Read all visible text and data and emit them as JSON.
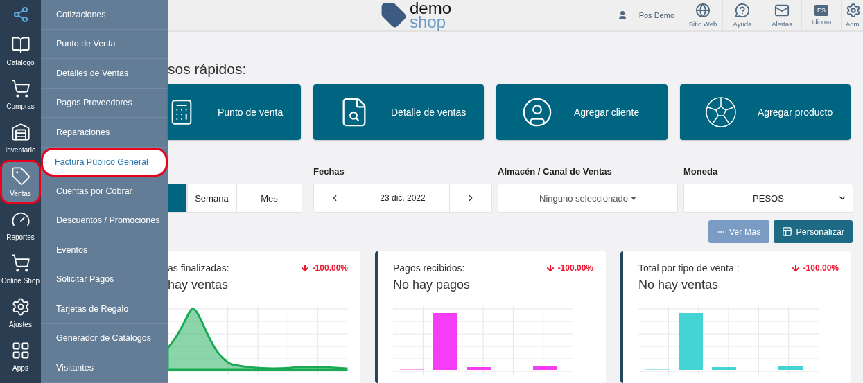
{
  "rail": {
    "items": [
      {
        "kind": "book",
        "label": "Catálogo",
        "selected": false,
        "annotated": false
      },
      {
        "kind": "cart-down",
        "label": "Compras",
        "selected": false,
        "annotated": false
      },
      {
        "kind": "warehouse",
        "label": "Inventario",
        "selected": false,
        "annotated": false
      },
      {
        "kind": "tag",
        "label": "Ventas",
        "selected": true,
        "annotated": true
      },
      {
        "kind": "gauge",
        "label": "Reportes",
        "selected": false,
        "annotated": false
      },
      {
        "kind": "cart",
        "label": "Online Shop",
        "selected": false,
        "annotated": false
      },
      {
        "kind": "gear",
        "label": "Ajustes",
        "selected": false,
        "annotated": false
      },
      {
        "kind": "apps",
        "label": "Apps",
        "selected": false,
        "annotated": false
      }
    ]
  },
  "flyout": {
    "items": [
      {
        "label": "Cotizaciones",
        "selected": false,
        "annotated": false
      },
      {
        "label": "Punto de Venta",
        "selected": false,
        "annotated": false
      },
      {
        "label": "Detalles de Ventas",
        "selected": false,
        "annotated": false
      },
      {
        "label": "Pagos Proveedores",
        "selected": false,
        "annotated": false
      },
      {
        "label": "Reparaciones",
        "selected": false,
        "annotated": false
      },
      {
        "label": "Factura Público General",
        "selected": true,
        "annotated": true
      },
      {
        "label": "Cuentas por Cobrar",
        "selected": false,
        "annotated": false
      },
      {
        "label": "Descuentos / Promociones",
        "selected": false,
        "annotated": false
      },
      {
        "label": "Eventos",
        "selected": false,
        "annotated": false
      },
      {
        "label": "Solicitar Pagos",
        "selected": false,
        "annotated": false
      },
      {
        "label": "Tarjetas de Regalo",
        "selected": false,
        "annotated": false
      },
      {
        "label": "Generador de Catálogos",
        "selected": false,
        "annotated": false
      },
      {
        "label": "Visitantes",
        "selected": false,
        "annotated": false
      }
    ]
  },
  "header": {
    "logo": {
      "line_1": "demo",
      "line_2": "shop"
    },
    "user": {
      "name": "iPos Demo"
    },
    "actions": [
      {
        "kind": "globe",
        "label": "Sitio Web"
      },
      {
        "kind": "help",
        "label": "Ayuda"
      },
      {
        "kind": "mail",
        "label": "Alertas"
      },
      {
        "kind": "language",
        "label": "Idioma",
        "badge": "ES"
      },
      {
        "kind": "gear",
        "label": "Admi"
      }
    ]
  },
  "quick_access": {
    "title": "sos rápidos:",
    "cards": [
      {
        "kind": "register",
        "label": "Punto de venta"
      },
      {
        "kind": "report",
        "label": "Detalle de ventas"
      },
      {
        "kind": "person",
        "label": "Agregar cliente"
      },
      {
        "kind": "ball",
        "label": "Agregar producto"
      }
    ]
  },
  "filters": {
    "period": [
      {
        "selected": true
      },
      {
        "label": "Semana",
        "selected": false
      },
      {
        "label": "Mes",
        "selected": false
      }
    ],
    "dates": {
      "label": "Fechas",
      "value": "23 dic. 2022"
    },
    "warehouse": {
      "label": "Almacén / Canal de Ventas",
      "value": "Ninguno seleccionado"
    },
    "currency": {
      "label": "Moneda",
      "value": "PESOS"
    }
  },
  "buttons": [
    {
      "kind": "more",
      "label": "Ver Más"
    },
    {
      "kind": "customize",
      "label": "Personalizar"
    }
  ],
  "stat_cards": [
    {
      "title": "as finalizadas:",
      "change": "-100.00%",
      "value": "hay ventas",
      "kind": "area",
      "color": "#1aaa55",
      "accent_border": false
    },
    {
      "title": "Pagos recibidos:",
      "change": "-100.00%",
      "value": "No hay pagos",
      "kind": "bar",
      "color": "#f53df5",
      "accent_border": true
    },
    {
      "title": "Total por tipo de venta :",
      "change": "-100.00%",
      "value": "No hay ventas",
      "kind": "bar",
      "color": "#45d4d4",
      "accent_border": true
    }
  ]
}
